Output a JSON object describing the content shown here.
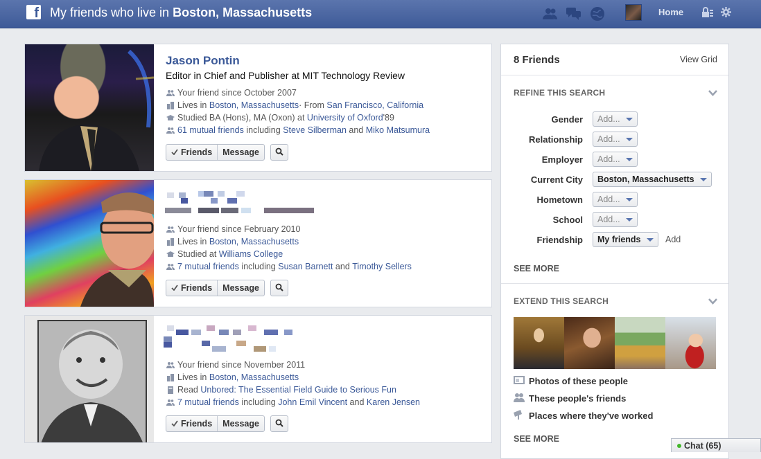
{
  "topbar": {
    "logo": "f",
    "title_prefix": "My friends who live in ",
    "title_place": "Boston, Massachusetts",
    "home_label": "Home",
    "icons": [
      "friend-requests-icon",
      "messages-icon",
      "notifications-icon",
      "privacy-icon",
      "settings-icon"
    ]
  },
  "results": [
    {
      "name": "Jason Pontin",
      "title": "Editor in Chief and Publisher at MIT Technology Review",
      "friend_since": "Your friend since October 2007",
      "lives_prefix": "Lives in ",
      "lives_city": "Boston, Massachusetts",
      "from_prefix": " · From ",
      "from_city": "San Francisco, California",
      "study_prefix": "Studied BA (Hons), MA (Oxon) at ",
      "study_school": "University of Oxford",
      "study_suffix": " '89",
      "mutual_count": "61 mutual friends",
      "mutual_including": " including ",
      "mutual_a": "Steve Silberman",
      "mutual_and": " and ",
      "mutual_b": "Miko Matsumura"
    },
    {
      "friend_since": "Your friend since February 2010",
      "lives_prefix": "Lives in ",
      "lives_city": "Boston, Massachusetts",
      "study_prefix": "Studied at ",
      "study_school": "Williams College",
      "mutual_count": "7 mutual friends",
      "mutual_including": " including ",
      "mutual_a": "Susan Barnett",
      "mutual_and": " and ",
      "mutual_b": "Timothy Sellers"
    },
    {
      "friend_since": "Your friend since November 2011",
      "lives_prefix": "Lives in ",
      "lives_city": "Boston, Massachusetts",
      "read_prefix": "Read ",
      "read_book": "Unbored: The Essential Field Guide to Serious Fun",
      "mutual_count": "7 mutual friends",
      "mutual_including": " including ",
      "mutual_a": "John Emil Vincent",
      "mutual_and": " and ",
      "mutual_b": "Karen Jensen"
    }
  ],
  "buttons": {
    "friends": "Friends",
    "message": "Message"
  },
  "sidebar": {
    "count": "8 Friends",
    "view_grid": "View Grid",
    "refine_title": "REFINE THIS SEARCH",
    "filters": [
      {
        "label": "Gender",
        "value": "Add..."
      },
      {
        "label": "Relationship",
        "value": "Add..."
      },
      {
        "label": "Employer",
        "value": "Add..."
      },
      {
        "label": "Current City",
        "value": "Boston, Massachusetts"
      },
      {
        "label": "Hometown",
        "value": "Add..."
      },
      {
        "label": "School",
        "value": "Add..."
      },
      {
        "label": "Friendship",
        "value": "My friends",
        "extra": "Add"
      }
    ],
    "see_more": "SEE MORE",
    "extend_title": "EXTEND THIS SEARCH",
    "extend_links": [
      "Photos of these people",
      "These people's friends",
      "Places where they've worked"
    ],
    "see_more_2": "SEE MORE"
  },
  "chat": {
    "label": "Chat (65)"
  },
  "colors": {
    "brand": "#3b5998",
    "topbar": "#4a65a0",
    "online": "#42b72a"
  }
}
